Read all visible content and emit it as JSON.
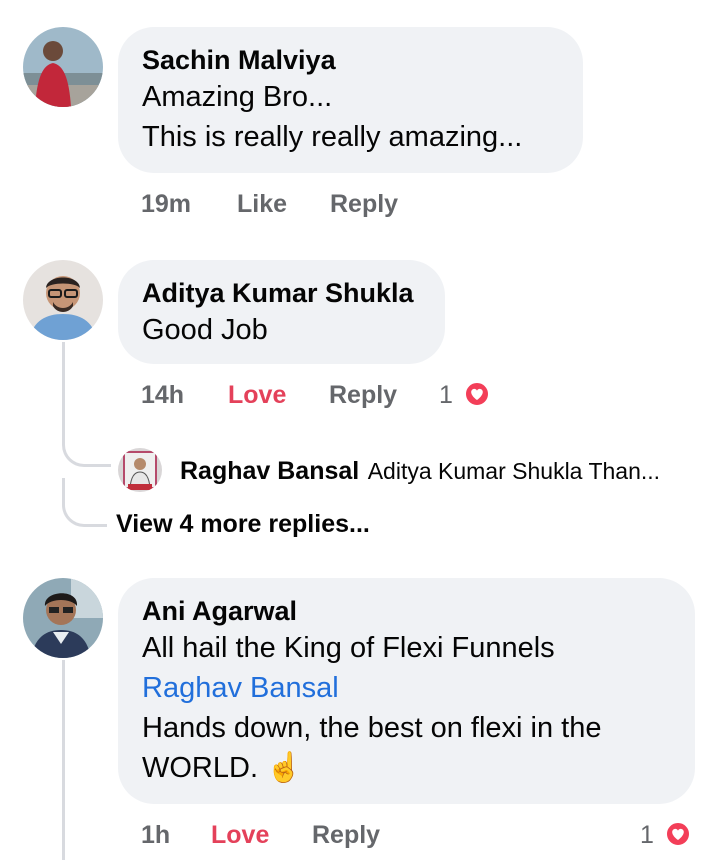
{
  "comments": [
    {
      "author": "Sachin Malviya",
      "lines": [
        "Amazing Bro...",
        "This is really really amazing..."
      ],
      "time": "19m",
      "like_label": "Like",
      "reply_label": "Reply"
    },
    {
      "author": "Aditya Kumar Shukla",
      "lines": [
        "Good Job"
      ],
      "time": "14h",
      "like_label": "Love",
      "reply_label": "Reply",
      "reaction_count": "1",
      "reaction_icon": "heart-icon",
      "reply_preview": {
        "author": "Raghav Bansal",
        "text": "Aditya Kumar Shukla Than..."
      },
      "view_more_label": "View 4 more replies..."
    },
    {
      "author": "Ani Agarwal",
      "lines": [
        "All hail the King of Flexi Funnels"
      ],
      "mention": "Raghav Bansal",
      "lines_after": [
        "Hands down, the best on flexi in the",
        "WORLD. "
      ],
      "emoji": "☝️",
      "time": "1h",
      "like_label": "Love",
      "reply_label": "Reply",
      "reaction_count": "1",
      "reaction_icon": "heart-icon"
    }
  ],
  "colors": {
    "bubble": "#f0f2f5",
    "love": "#e4415a",
    "heart": "#f33e58",
    "mention": "#216fdb",
    "meta": "#65676b"
  }
}
